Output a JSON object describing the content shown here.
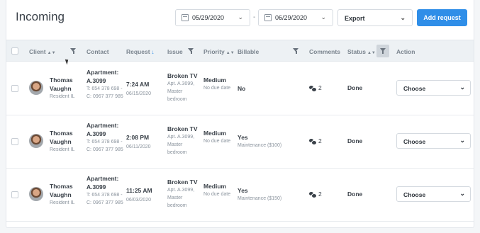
{
  "header": {
    "title": "Incoming",
    "date_from": "05/29/2020",
    "date_separator": "-",
    "date_to": "06/29/2020",
    "export_label": "Export",
    "add_label": "Add request"
  },
  "columns": {
    "client": "Client",
    "contact": "Contact",
    "request": "Request",
    "issue": "Issue",
    "priority": "Priority",
    "billable": "Billable",
    "comments": "Comments",
    "status": "Status",
    "action": "Action"
  },
  "rows": [
    {
      "first": "Thomas",
      "last": "Vaughn",
      "role": "Resident IL",
      "contact_title": "Apartment: A.3099",
      "contact_detail": "T: 654 378 698 - C: 0967 377 985",
      "time": "7:24 AM",
      "date": "06/15/2020",
      "issue": "Broken TV",
      "issue_detail": "Apt. A.3099, Master bedroom",
      "priority": "Medium",
      "due": "No due date",
      "billable": "No",
      "billable_detail": "",
      "comments": "2",
      "status": "Done",
      "action": "Choose"
    },
    {
      "first": "Thomas",
      "last": "Vaughn",
      "role": "Resident IL",
      "contact_title": "Apartment: A.3099",
      "contact_detail": "T: 654 378 698 - C: 0967 377 985",
      "time": "2:08 PM",
      "date": "06/11/2020",
      "issue": "Broken TV",
      "issue_detail": "Apt. A.3099, Master bedroom",
      "priority": "Medium",
      "due": "No due date",
      "billable": "Yes",
      "billable_detail": "Maintenance ($100)",
      "comments": "2",
      "status": "Done",
      "action": "Choose"
    },
    {
      "first": "Thomas",
      "last": "Vaughn",
      "role": "Resident IL",
      "contact_title": "Apartment: A.3099",
      "contact_detail": "T: 654 378 698 - C: 0967 377 985",
      "time": "11:25 AM",
      "date": "06/03/2020",
      "issue": "Broken TV",
      "issue_detail": "Apt. A.3099, Master bedroom",
      "priority": "Medium",
      "due": "No due date",
      "billable": "Yes",
      "billable_detail": "Maintenance ($150)",
      "comments": "2",
      "status": "Done",
      "action": "Choose"
    }
  ]
}
